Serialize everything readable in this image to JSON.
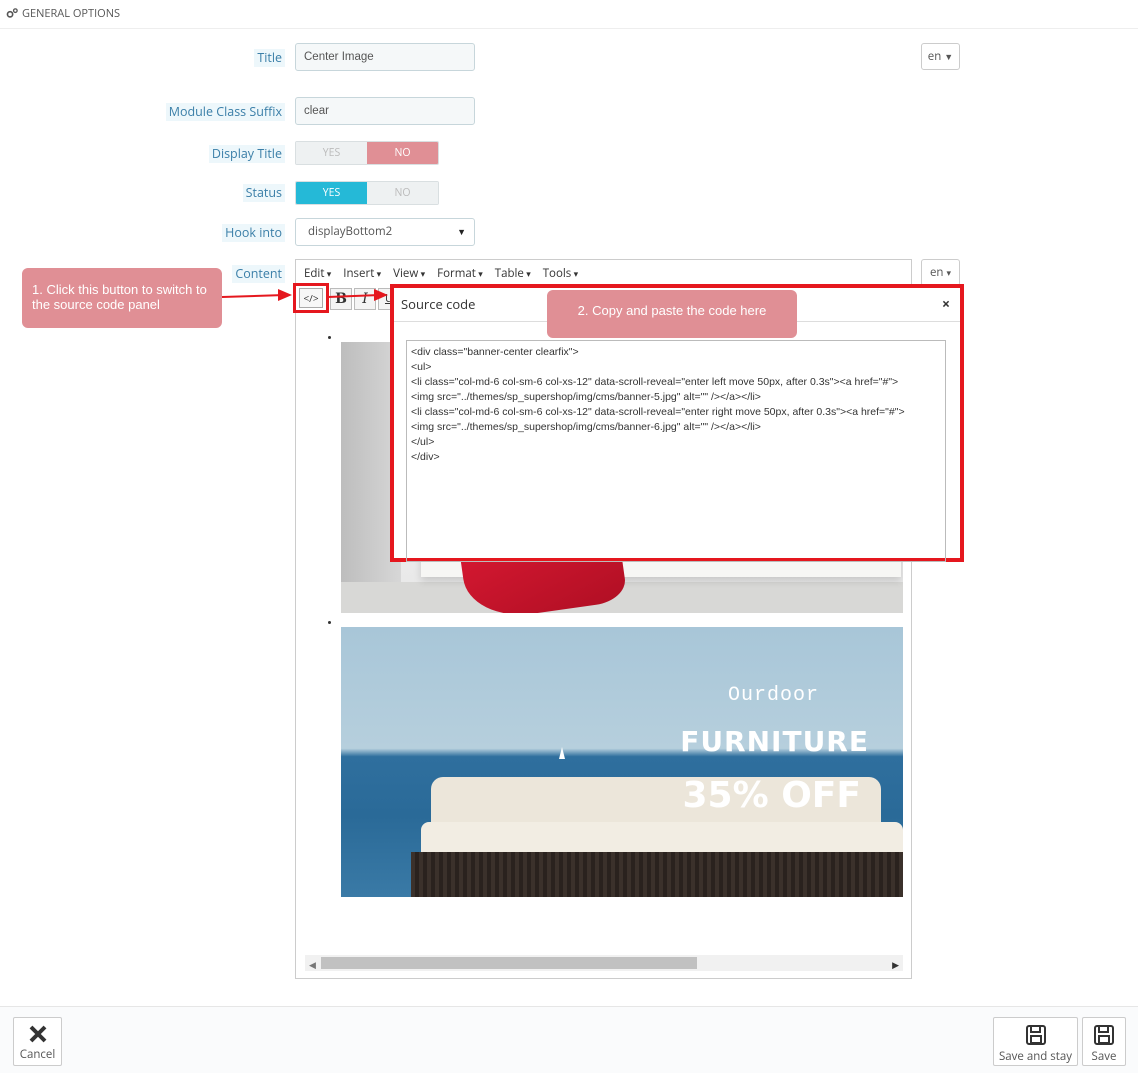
{
  "panel": {
    "heading": "GENERAL OPTIONS"
  },
  "form": {
    "title_label": "Title",
    "title_value": "Center Image",
    "lang": "en",
    "suffix_label": "Module Class Suffix",
    "suffix_value": "clear",
    "display_title_label": "Display Title",
    "status_label": "Status",
    "yes": "YES",
    "no": "NO",
    "display_title_selected": "NO",
    "status_selected": "YES",
    "hook_label": "Hook into",
    "hook_value": "displayBottom2",
    "content_label": "Content"
  },
  "editor": {
    "menus": [
      "Edit",
      "Insert",
      "View",
      "Format",
      "Table",
      "Tools"
    ],
    "source_icon": "</>",
    "bold": "B",
    "italic": "I",
    "banner": {
      "line1": "Ourdoor",
      "line2": "FURNITURE",
      "line3": "35% OFF"
    }
  },
  "dialog": {
    "title": "Source code",
    "close": "×",
    "code": "<div class=\"banner-center clearfix\">\n<ul>\n<li class=\"col-md-6 col-sm-6 col-xs-12\" data-scroll-reveal=\"enter left move 50px, after 0.3s\"><a href=\"#\">\n<img src=\"../themes/sp_supershop/img/cms/banner-5.jpg\" alt=\"\" /></a></li>\n<li class=\"col-md-6 col-sm-6 col-xs-12\" data-scroll-reveal=\"enter right move 50px, after 0.3s\"><a href=\"#\">\n<img src=\"../themes/sp_supershop/img/cms/banner-6.jpg\" alt=\"\" /></a></li>\n</ul>\n</div>"
  },
  "callouts": {
    "step1": "1. Click this button to switch to the source code panel",
    "step2": "2. Copy and paste the code here"
  },
  "footer": {
    "cancel": "Cancel",
    "save_and_stay": "Save and stay",
    "save": "Save"
  },
  "colors": {
    "accent_blue": "#25b9d7",
    "no_red": "#e08f95",
    "highlight_red": "#e5171e"
  }
}
